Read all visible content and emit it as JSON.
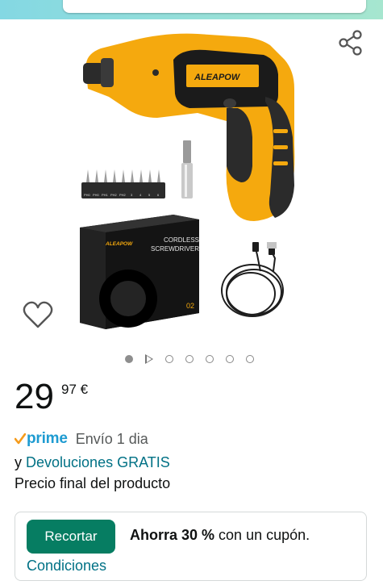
{
  "header": {
    "bar_colors": [
      "#84d8e3",
      "#a6e6cf"
    ]
  },
  "product": {
    "brand_label": "ALEAPOW",
    "box_text_line1": "CORDLESS",
    "box_text_line2": "SCREWDRIVER",
    "box_number": "02",
    "bit_labels": [
      "PH0",
      "PH0",
      "PH1",
      "PH2",
      "PH2",
      "3",
      "4",
      "5",
      "6"
    ],
    "gallery": {
      "total": 7,
      "active": 1,
      "video_index": 2
    }
  },
  "price": {
    "integer": "29",
    "decimal_currency": "97 €"
  },
  "shipping": {
    "prime": "prime",
    "envio": "Envío 1 dia",
    "prefix": "y",
    "returns": "Devoluciones GRATIS",
    "final_price": "Precio final del producto"
  },
  "coupon": {
    "button": "Recortar",
    "save_bold": "Ahorra 30 %",
    "save_rest": " con un cupón.",
    "conditions": "Condiciones"
  },
  "colors": {
    "accent": "#067d62",
    "link": "#007185",
    "prime": "#1e9bd1",
    "tool": "#f5a90e"
  },
  "icons": [
    "share-icon",
    "heart-icon",
    "prime-check-icon",
    "video-play-icon"
  ]
}
